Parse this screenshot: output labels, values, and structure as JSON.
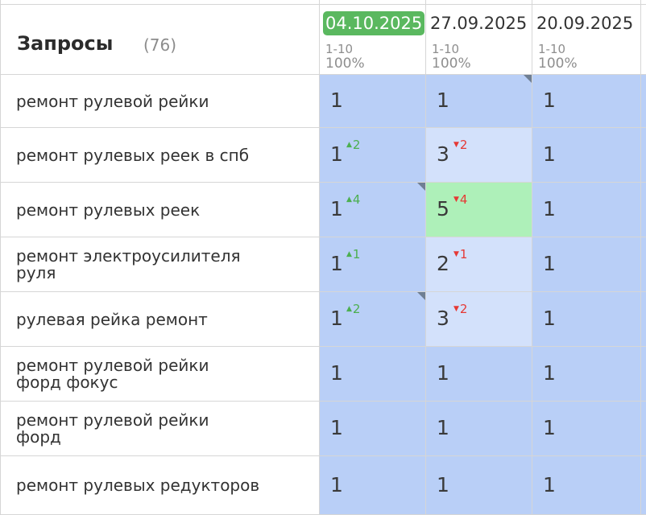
{
  "header": {
    "title": "Запросы",
    "count": "(76)"
  },
  "dates": [
    {
      "label": "04.10.2025",
      "range": "1-10",
      "percent": "100%",
      "active": true
    },
    {
      "label": "27.09.2025",
      "range": "1-10",
      "percent": "100%",
      "active": false
    },
    {
      "label": "20.09.2025",
      "range": "1-10",
      "percent": "100%",
      "active": false
    }
  ],
  "colors": {
    "blue": "#b9cff7",
    "light_blue": "#d3e1fb",
    "green": "#aef0b9",
    "active_date": "#5ab85f",
    "up": "#4caf50",
    "down": "#e53935"
  },
  "rows": [
    {
      "query": [
        "ремонт рулевой рейки"
      ],
      "cells": [
        {
          "pos": "1",
          "chg": "",
          "dir": "",
          "bg": "blue",
          "corner": false
        },
        {
          "pos": "1",
          "chg": "",
          "dir": "",
          "bg": "blue",
          "corner": true
        },
        {
          "pos": "1",
          "chg": "",
          "dir": "",
          "bg": "blue",
          "corner": false
        }
      ]
    },
    {
      "query": [
        "ремонт рулевых реек в спб"
      ],
      "cells": [
        {
          "pos": "1",
          "chg": "2",
          "dir": "up",
          "bg": "blue",
          "corner": false
        },
        {
          "pos": "3",
          "chg": "2",
          "dir": "down",
          "bg": "light_blue",
          "corner": false
        },
        {
          "pos": "1",
          "chg": "",
          "dir": "",
          "bg": "blue",
          "corner": false
        }
      ]
    },
    {
      "query": [
        "ремонт рулевых реек"
      ],
      "cells": [
        {
          "pos": "1",
          "chg": "4",
          "dir": "up",
          "bg": "blue",
          "corner": true
        },
        {
          "pos": "5",
          "chg": "4",
          "dir": "down",
          "bg": "green",
          "corner": false
        },
        {
          "pos": "1",
          "chg": "",
          "dir": "",
          "bg": "blue",
          "corner": false
        }
      ]
    },
    {
      "query": [
        "ремонт электроусилителя",
        "руля"
      ],
      "cells": [
        {
          "pos": "1",
          "chg": "1",
          "dir": "up",
          "bg": "blue",
          "corner": false
        },
        {
          "pos": "2",
          "chg": "1",
          "dir": "down",
          "bg": "light_blue",
          "corner": false
        },
        {
          "pos": "1",
          "chg": "",
          "dir": "",
          "bg": "blue",
          "corner": false
        }
      ]
    },
    {
      "query": [
        "рулевая рейка ремонт"
      ],
      "cells": [
        {
          "pos": "1",
          "chg": "2",
          "dir": "up",
          "bg": "blue",
          "corner": true
        },
        {
          "pos": "3",
          "chg": "2",
          "dir": "down",
          "bg": "light_blue",
          "corner": false
        },
        {
          "pos": "1",
          "chg": "",
          "dir": "",
          "bg": "blue",
          "corner": false
        }
      ]
    },
    {
      "query": [
        "ремонт рулевой рейки",
        "форд фокус"
      ],
      "cells": [
        {
          "pos": "1",
          "chg": "",
          "dir": "",
          "bg": "blue",
          "corner": false
        },
        {
          "pos": "1",
          "chg": "",
          "dir": "",
          "bg": "blue",
          "corner": false
        },
        {
          "pos": "1",
          "chg": "",
          "dir": "",
          "bg": "blue",
          "corner": false
        }
      ]
    },
    {
      "query": [
        "ремонт рулевой рейки",
        "форд"
      ],
      "cells": [
        {
          "pos": "1",
          "chg": "",
          "dir": "",
          "bg": "blue",
          "corner": false
        },
        {
          "pos": "1",
          "chg": "",
          "dir": "",
          "bg": "blue",
          "corner": false
        },
        {
          "pos": "1",
          "chg": "",
          "dir": "",
          "bg": "blue",
          "corner": false
        }
      ]
    },
    {
      "query": [
        "ремонт рулевых редукторов"
      ],
      "cells": [
        {
          "pos": "1",
          "chg": "",
          "dir": "",
          "bg": "blue",
          "corner": false
        },
        {
          "pos": "1",
          "chg": "",
          "dir": "",
          "bg": "blue",
          "corner": false
        },
        {
          "pos": "1",
          "chg": "",
          "dir": "",
          "bg": "blue",
          "corner": false
        }
      ]
    }
  ]
}
